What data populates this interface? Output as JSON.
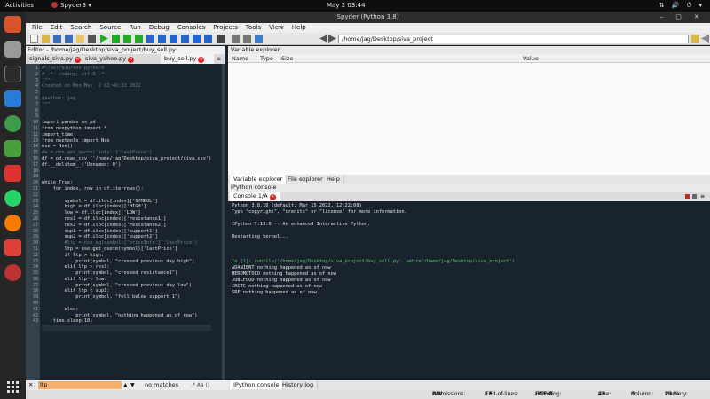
{
  "topbar": {
    "activities": "Activities",
    "app_name": "Spyder3",
    "clock": "May 2  03:44"
  },
  "window": {
    "title": "Spyder (Python 3.8)"
  },
  "menu": [
    "File",
    "Edit",
    "Search",
    "Source",
    "Run",
    "Debug",
    "Consoles",
    "Projects",
    "Tools",
    "View",
    "Help"
  ],
  "toolbar": {
    "path": "/home/jag/Desktop/siva_project"
  },
  "editor": {
    "header": "Editor - /home/jag/Desktop/siva_project/buy_sell.py",
    "tabs": [
      {
        "label": "signals_siva.py"
      },
      {
        "label": "siva_yahoo.py"
      },
      {
        "label": "buy_sell.py",
        "active": true
      }
    ],
    "line_numbers": [
      "1",
      "2",
      "3",
      "4",
      "5",
      "6",
      "7",
      "8",
      "9",
      "10",
      "11",
      "12",
      "13",
      "14",
      "15",
      "16",
      "17",
      "18",
      "19",
      "20",
      "21",
      "22",
      "23",
      "24",
      "25",
      "26",
      "27",
      "28",
      "29",
      "30",
      "31",
      "32",
      "33",
      "34",
      "35",
      "36",
      "37",
      "38",
      "39",
      "40",
      "41",
      "42",
      "43"
    ],
    "lines": [
      "#!/usr/bin/env python3",
      "# -*- coding: utf-8 -*-",
      "\"\"\"",
      "Created on Mon May  2 02:46:33 2022",
      "",
      "@author: jag",
      "\"\"\"",
      "",
      "",
      "import pandas as pd",
      "from nsepython import *",
      "import time",
      "from nsetools import Nse",
      "nse = Nse()",
      "#a = nse.get_quote('infy')['lastPrice']",
      "df = pd.read_csv ('/home/jag/Desktop/siva_project/siva.csv')",
      "df.__delitem__('Unnamed: 0')",
      "",
      "",
      "while True:",
      "    for index, row in df.iterrows():",
      "",
      "        symbol = df.iloc[index]['SYMBOL']",
      "        high = df.iloc[index]['HIGH']",
      "        low = df.iloc[index]['LOW']",
      "        res1 = df.iloc[index]['resistance1']",
      "        res2 = df.iloc[index]['resistance2']",
      "        sup1 = df.iloc[index]['support1']",
      "        sup2 = df.iloc[index]['support2']",
      "        #ltp = nse_eq(symbol)['priceInfo']['lastPrice']",
      "        ltp = nse.get_quote(symbol)['lastPrice']",
      "        if ltp > high:",
      "            print(symbol, \"crossed previous day high\")",
      "        elif ltp > res1:",
      "            print(symbol, \"crossed resistance1\")",
      "        elif ltp < low:",
      "            print(symbol, \"crossed previous day low\")",
      "        elif ltp < sup1:",
      "            print(symbol, \"fell below support 1\")",
      "",
      "        else:",
      "            print(symbol, \"nothing happened as of now\")",
      "    time.sleep(10)",
      ""
    ]
  },
  "variable_explorer": {
    "title": "Variable explorer",
    "columns": [
      "Name",
      "Type",
      "Size",
      "Value"
    ],
    "tabs": [
      "Variable explorer",
      "File explorer",
      "Help"
    ]
  },
  "ipython": {
    "title": "IPython console",
    "tab": "Console 1/A",
    "output": [
      "Python 3.8.10 (default, Mar 15 2022, 12:22:08)",
      "Type \"copyright\", \"credits\" or \"license\" for more information.",
      "",
      "IPython 7.13.0 -- An enhanced Interactive Python.",
      "",
      "Restarting kernel...",
      "",
      "",
      "",
      "In [1]: runfile('/home/jag/Desktop/siva_project/buy_sell.py', wdir='/home/jag/Desktop/siva_project')",
      "ADANIENT nothing happened as of now",
      "HEROMOTOCO nothing happened as of now",
      "JUBLFOOD nothing happened as of now",
      "IRCTC nothing happened as of now",
      "SRF nothing happened as of now"
    ],
    "bottom_tabs": [
      "IPython console",
      "History log"
    ]
  },
  "findbar": {
    "query": "ltp",
    "status": "no matches"
  },
  "status": {
    "permissions_label": "Permissions:",
    "permissions": "RW",
    "eol_label": "End-of-lines:",
    "eol": "LF",
    "encoding_label": "Encoding:",
    "encoding": "UTF-8",
    "line_label": "Line:",
    "line": "43",
    "column_label": "Column:",
    "column": "9",
    "memory_label": "Memory:",
    "memory": "23 %"
  },
  "colors": {
    "editor_bg": "#19232d",
    "accent_green": "#5ec36a",
    "close_red": "#dd2222",
    "find_highlight": "#f5b06e"
  }
}
